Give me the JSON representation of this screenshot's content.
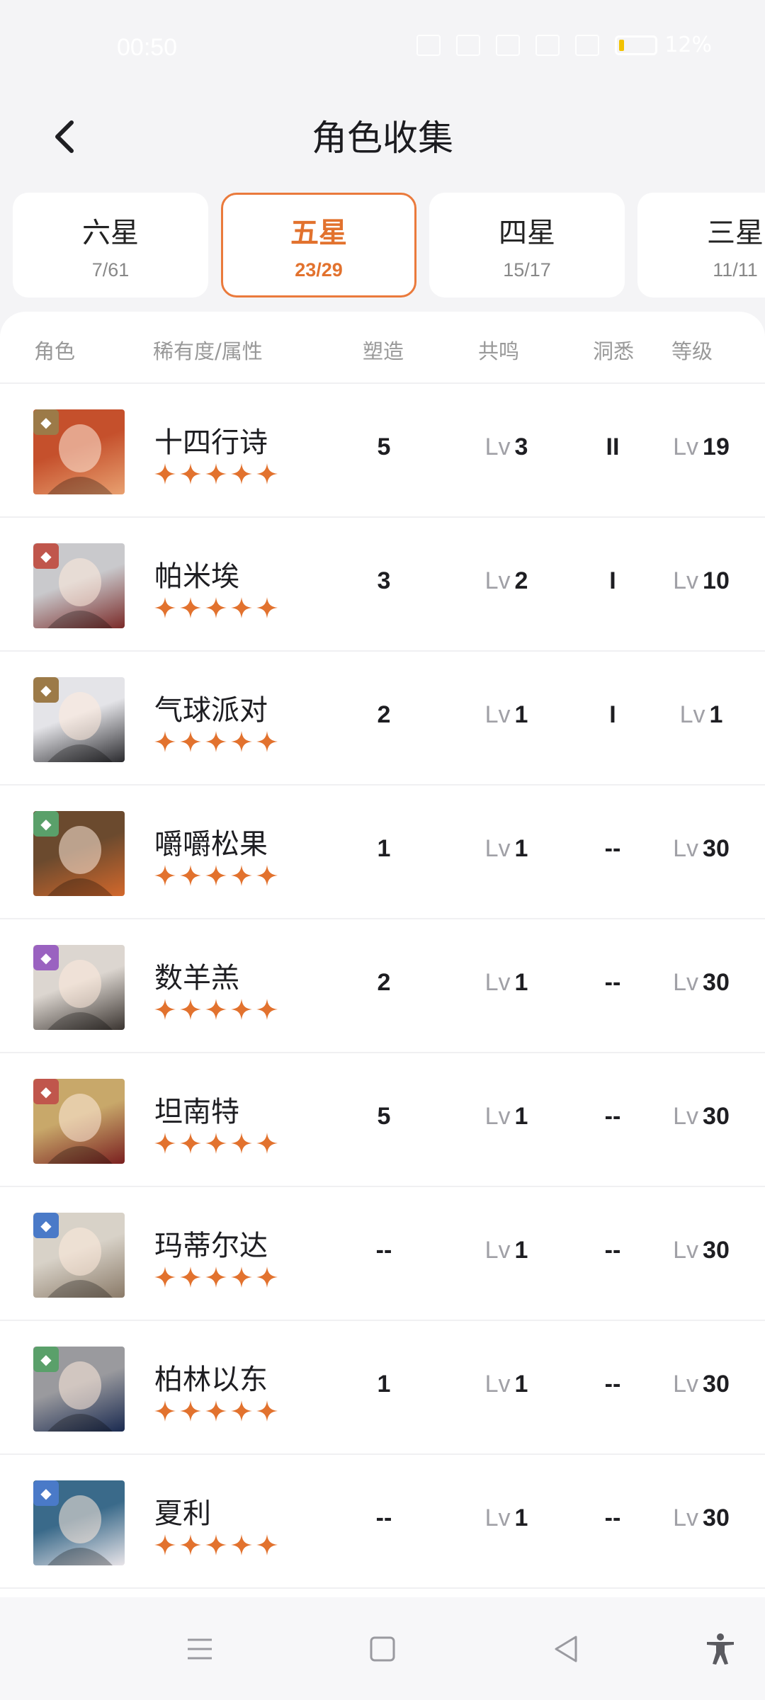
{
  "status_bar": {
    "time": "00:50",
    "battery": "12%",
    "icons": [
      "mute-icon",
      "wifi-icon",
      "nfc-icon",
      "signal-icon",
      "signal-icon",
      "battery-icon"
    ]
  },
  "header": {
    "title": "角色收集",
    "back_icon": "chevron-left-icon"
  },
  "tabs": [
    {
      "label": "六星",
      "count": "7/61",
      "active": false
    },
    {
      "label": "五星",
      "count": "23/29",
      "active": true
    },
    {
      "label": "四星",
      "count": "15/17",
      "active": false
    },
    {
      "label": "三星",
      "count": "11/11",
      "active": false
    }
  ],
  "columns": {
    "role": "角色",
    "rarity": "稀有度/属性",
    "shape": "塑造",
    "resonance": "共鸣",
    "insight": "洞悉",
    "level": "等级"
  },
  "accent": "#e2722e",
  "rows": [
    {
      "name": "十四行诗",
      "stars": 5,
      "attribute": "beast",
      "attr_color": "#9c7a48",
      "shape": "5",
      "resonance_prefix": "Lv",
      "resonance": "3",
      "insight": "II",
      "level_prefix": "Lv",
      "level": "19",
      "bg": [
        "#c5502c",
        "#e8a070"
      ]
    },
    {
      "name": "帕米埃",
      "stars": 5,
      "attribute": "plant-claw",
      "attr_color": "#c0564c",
      "shape": "3",
      "resonance_prefix": "Lv",
      "resonance": "2",
      "insight": "I",
      "level_prefix": "Lv",
      "level": "10",
      "bg": [
        "#c9c9cc",
        "#7a2a28"
      ]
    },
    {
      "name": "气球派对",
      "stars": 5,
      "attribute": "beast",
      "attr_color": "#9c7a48",
      "shape": "2",
      "resonance_prefix": "Lv",
      "resonance": "1",
      "insight": "I",
      "level_prefix": "Lv",
      "level": "1",
      "bg": [
        "#e4e4e8",
        "#2a2a2e"
      ]
    },
    {
      "name": "嚼嚼松果",
      "stars": 5,
      "attribute": "plant",
      "attr_color": "#5aa06a",
      "shape": "1",
      "resonance_prefix": "Lv",
      "resonance": "1",
      "insight": "--",
      "level_prefix": "Lv",
      "level": "30",
      "bg": [
        "#6b4a2e",
        "#d2682c"
      ]
    },
    {
      "name": "数羊羔",
      "stars": 5,
      "attribute": "spirit",
      "attr_color": "#9a62c0",
      "shape": "2",
      "resonance_prefix": "Lv",
      "resonance": "1",
      "insight": "--",
      "level_prefix": "Lv",
      "level": "30",
      "bg": [
        "#dcd6d0",
        "#3a3430"
      ]
    },
    {
      "name": "坦南特",
      "stars": 5,
      "attribute": "plant-claw",
      "attr_color": "#c0564c",
      "shape": "5",
      "resonance_prefix": "Lv",
      "resonance": "1",
      "insight": "--",
      "level_prefix": "Lv",
      "level": "30",
      "bg": [
        "#c8a86a",
        "#7a2020"
      ]
    },
    {
      "name": "玛蒂尔达",
      "stars": 5,
      "attribute": "star",
      "attr_color": "#4a7ac8",
      "shape": "--",
      "resonance_prefix": "Lv",
      "resonance": "1",
      "insight": "--",
      "level_prefix": "Lv",
      "level": "30",
      "bg": [
        "#d8d2c8",
        "#8a7a68"
      ]
    },
    {
      "name": "柏林以东",
      "stars": 5,
      "attribute": "plant",
      "attr_color": "#5aa06a",
      "shape": "1",
      "resonance_prefix": "Lv",
      "resonance": "1",
      "insight": "--",
      "level_prefix": "Lv",
      "level": "30",
      "bg": [
        "#9a9a9e",
        "#1a2a50"
      ]
    },
    {
      "name": "夏利",
      "stars": 5,
      "attribute": "star",
      "attr_color": "#4a7ac8",
      "shape": "--",
      "resonance_prefix": "Lv",
      "resonance": "1",
      "insight": "--",
      "level_prefix": "Lv",
      "level": "30",
      "bg": [
        "#3a6a8a",
        "#e8e4e8"
      ]
    }
  ],
  "nav": [
    "menu-icon",
    "home-icon",
    "back-icon",
    "accessibility-icon"
  ]
}
